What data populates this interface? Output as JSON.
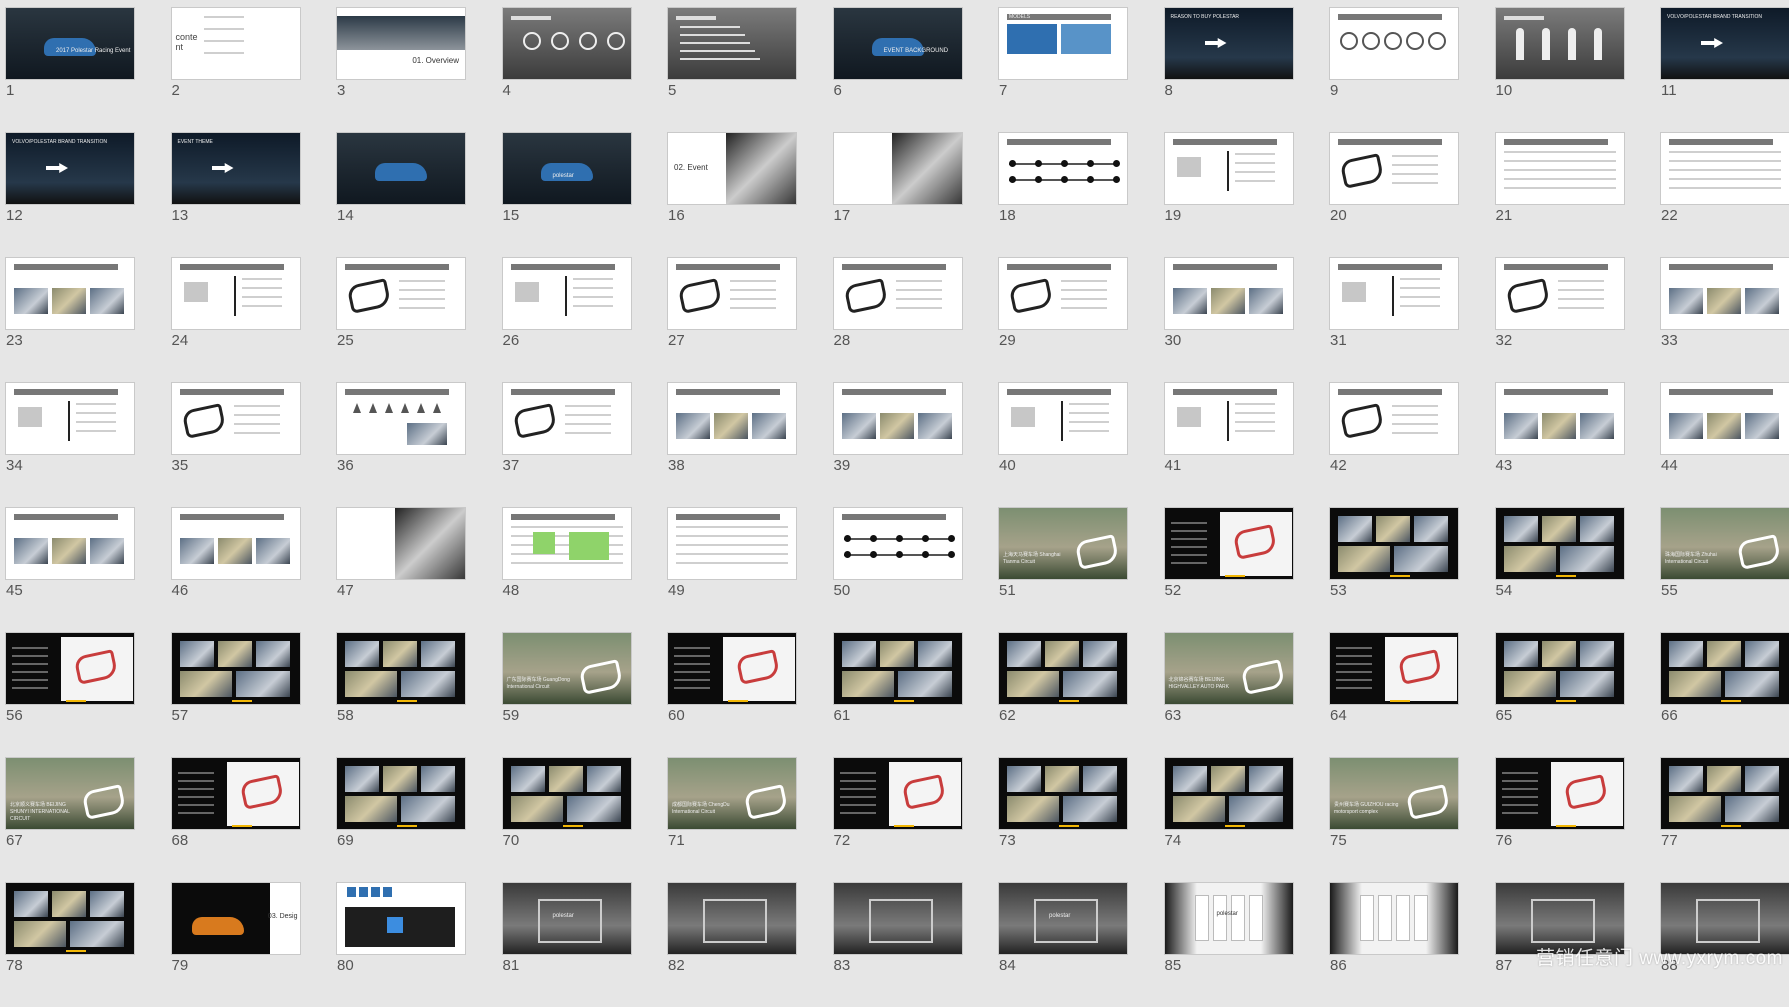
{
  "slides": [
    {
      "n": "1",
      "theme": "car-blue",
      "text": "2017 Polestar Racing Event"
    },
    {
      "n": "2",
      "theme": "contents",
      "text": "conte nt"
    },
    {
      "n": "3",
      "theme": "overview",
      "text": "01. Overview"
    },
    {
      "n": "4",
      "theme": "gray-icons",
      "text": ""
    },
    {
      "n": "5",
      "theme": "gray-text",
      "text": ""
    },
    {
      "n": "6",
      "theme": "car-photo",
      "text": "EVENT BACKGROUND"
    },
    {
      "n": "7",
      "theme": "models",
      "text": "MODELS"
    },
    {
      "n": "8",
      "theme": "night",
      "text": "REASON TO BUY POLESTAR"
    },
    {
      "n": "9",
      "theme": "icons-white",
      "text": "TARGET AUDIENCE"
    },
    {
      "n": "10",
      "theme": "people-dark",
      "text": ""
    },
    {
      "n": "11",
      "theme": "night",
      "text": "VOLVO/POLESTAR BRAND TRANSITION"
    },
    {
      "n": "12",
      "theme": "night",
      "text": "VOLVO/POLESTAR BRAND TRANSITION"
    },
    {
      "n": "13",
      "theme": "night",
      "text": "EVENT THEME"
    },
    {
      "n": "14",
      "theme": "car-blue",
      "text": ""
    },
    {
      "n": "15",
      "theme": "car-blue",
      "text": "polestar"
    },
    {
      "n": "16",
      "theme": "event",
      "text": "02. Event"
    },
    {
      "n": "17",
      "theme": "event",
      "text": ""
    },
    {
      "n": "18",
      "theme": "timeline",
      "text": "Time schedule"
    },
    {
      "n": "19",
      "theme": "strategy",
      "text": "Event Time Strategy"
    },
    {
      "n": "20",
      "theme": "track",
      "text": "Event Time Strategy"
    },
    {
      "n": "21",
      "theme": "table",
      "text": "Agenda"
    },
    {
      "n": "22",
      "theme": "table",
      "text": "Agenda"
    },
    {
      "n": "23",
      "theme": "photo-row",
      "text": "dealer & sales training"
    },
    {
      "n": "24",
      "theme": "diagram",
      "text": "dealer & sales training"
    },
    {
      "n": "25",
      "theme": "track",
      "text": "Racing experience"
    },
    {
      "n": "26",
      "theme": "diagram",
      "text": "dealer & sales training"
    },
    {
      "n": "27",
      "theme": "track",
      "text": "Racing experience"
    },
    {
      "n": "28",
      "theme": "course",
      "text": "course experience"
    },
    {
      "n": "29",
      "theme": "course",
      "text": "course experience"
    },
    {
      "n": "30",
      "theme": "photo-row",
      "text": "media/KOL"
    },
    {
      "n": "31",
      "theme": "diagram",
      "text": "media/KOL"
    },
    {
      "n": "32",
      "theme": "track",
      "text": "media/KOL"
    },
    {
      "n": "33",
      "theme": "photo-row",
      "text": "Polestar potential customer"
    },
    {
      "n": "34",
      "theme": "diagram",
      "text": "Polestar potential customer"
    },
    {
      "n": "35",
      "theme": "track",
      "text": "Driving school"
    },
    {
      "n": "36",
      "theme": "cones",
      "text": "Driving school"
    },
    {
      "n": "37",
      "theme": "track",
      "text": "Driving school"
    },
    {
      "n": "38",
      "theme": "photo-row",
      "text": "Driving school"
    },
    {
      "n": "39",
      "theme": "photo-row",
      "text": "current customer"
    },
    {
      "n": "40",
      "theme": "diagram",
      "text": "current customer"
    },
    {
      "n": "41",
      "theme": "diagram",
      "text": "current customer"
    },
    {
      "n": "42",
      "theme": "track",
      "text": "current customer"
    },
    {
      "n": "43",
      "theme": "photo-row",
      "text": "Event highlight"
    },
    {
      "n": "44",
      "theme": "photo-row",
      "text": "Event highlight"
    },
    {
      "n": "45",
      "theme": "photo-row",
      "text": "media/KOL"
    },
    {
      "n": "46",
      "theme": "photo-row",
      "text": "Event highlight"
    },
    {
      "n": "47",
      "theme": "event",
      "text": ""
    },
    {
      "n": "48",
      "theme": "green-table",
      "text": "Site schedule"
    },
    {
      "n": "49",
      "theme": "table",
      "text": "Site contrast"
    },
    {
      "n": "50",
      "theme": "timeline",
      "text": "Time schedule"
    },
    {
      "n": "51",
      "theme": "aerial",
      "text": "上海天马赛车场 Shanghai Tianma Circuit"
    },
    {
      "n": "52",
      "theme": "black-map",
      "text": ""
    },
    {
      "n": "53",
      "theme": "black-photos",
      "text": ""
    },
    {
      "n": "54",
      "theme": "black-photos",
      "text": ""
    },
    {
      "n": "55",
      "theme": "aerial",
      "text": "珠海国际赛车场 Zhuhai International Circuit"
    },
    {
      "n": "56",
      "theme": "black-map",
      "text": ""
    },
    {
      "n": "57",
      "theme": "black-photos",
      "text": ""
    },
    {
      "n": "58",
      "theme": "black-photos",
      "text": ""
    },
    {
      "n": "59",
      "theme": "aerial",
      "text": "广东国际赛车场 GuangDong International Circuit"
    },
    {
      "n": "60",
      "theme": "black-map",
      "text": ""
    },
    {
      "n": "61",
      "theme": "black-photos",
      "text": ""
    },
    {
      "n": "62",
      "theme": "black-photos",
      "text": ""
    },
    {
      "n": "63",
      "theme": "aerial",
      "text": "北京锦谷赛车场 BEIJING HIGHVALLEY AUTO PARK"
    },
    {
      "n": "64",
      "theme": "black-map",
      "text": ""
    },
    {
      "n": "65",
      "theme": "black-photos",
      "text": ""
    },
    {
      "n": "66",
      "theme": "black-photos",
      "text": ""
    },
    {
      "n": "67",
      "theme": "aerial",
      "text": "北京顺义赛车场 BEIJING SHUNYI INTERNATIONAL CIRCUIT"
    },
    {
      "n": "68",
      "theme": "black-map",
      "text": ""
    },
    {
      "n": "69",
      "theme": "black-photos",
      "text": ""
    },
    {
      "n": "70",
      "theme": "black-photos",
      "text": ""
    },
    {
      "n": "71",
      "theme": "aerial",
      "text": "成都国际赛车场 ChengDu International Circuit"
    },
    {
      "n": "72",
      "theme": "black-map",
      "text": ""
    },
    {
      "n": "73",
      "theme": "black-photos",
      "text": ""
    },
    {
      "n": "74",
      "theme": "black-photos",
      "text": ""
    },
    {
      "n": "75",
      "theme": "aerial",
      "text": "贵州赛车场 GUIZHOU racing motorsport complex"
    },
    {
      "n": "76",
      "theme": "black-map",
      "text": ""
    },
    {
      "n": "77",
      "theme": "black-photos",
      "text": ""
    },
    {
      "n": "78",
      "theme": "black-photos",
      "text": ""
    },
    {
      "n": "79",
      "theme": "car-night",
      "text": "03. Desig"
    },
    {
      "n": "80",
      "theme": "floorplan",
      "text": ""
    },
    {
      "n": "81",
      "theme": "room",
      "text": "polestar"
    },
    {
      "n": "82",
      "theme": "room",
      "text": ""
    },
    {
      "n": "83",
      "theme": "room",
      "text": ""
    },
    {
      "n": "84",
      "theme": "room",
      "text": "polestar"
    },
    {
      "n": "85",
      "theme": "white-room",
      "text": "polestar"
    },
    {
      "n": "86",
      "theme": "white-room",
      "text": ""
    },
    {
      "n": "87",
      "theme": "corridor",
      "text": ""
    },
    {
      "n": "88",
      "theme": "corridor",
      "text": ""
    }
  ],
  "watermark": "营销任意门 www.yxrym.com"
}
